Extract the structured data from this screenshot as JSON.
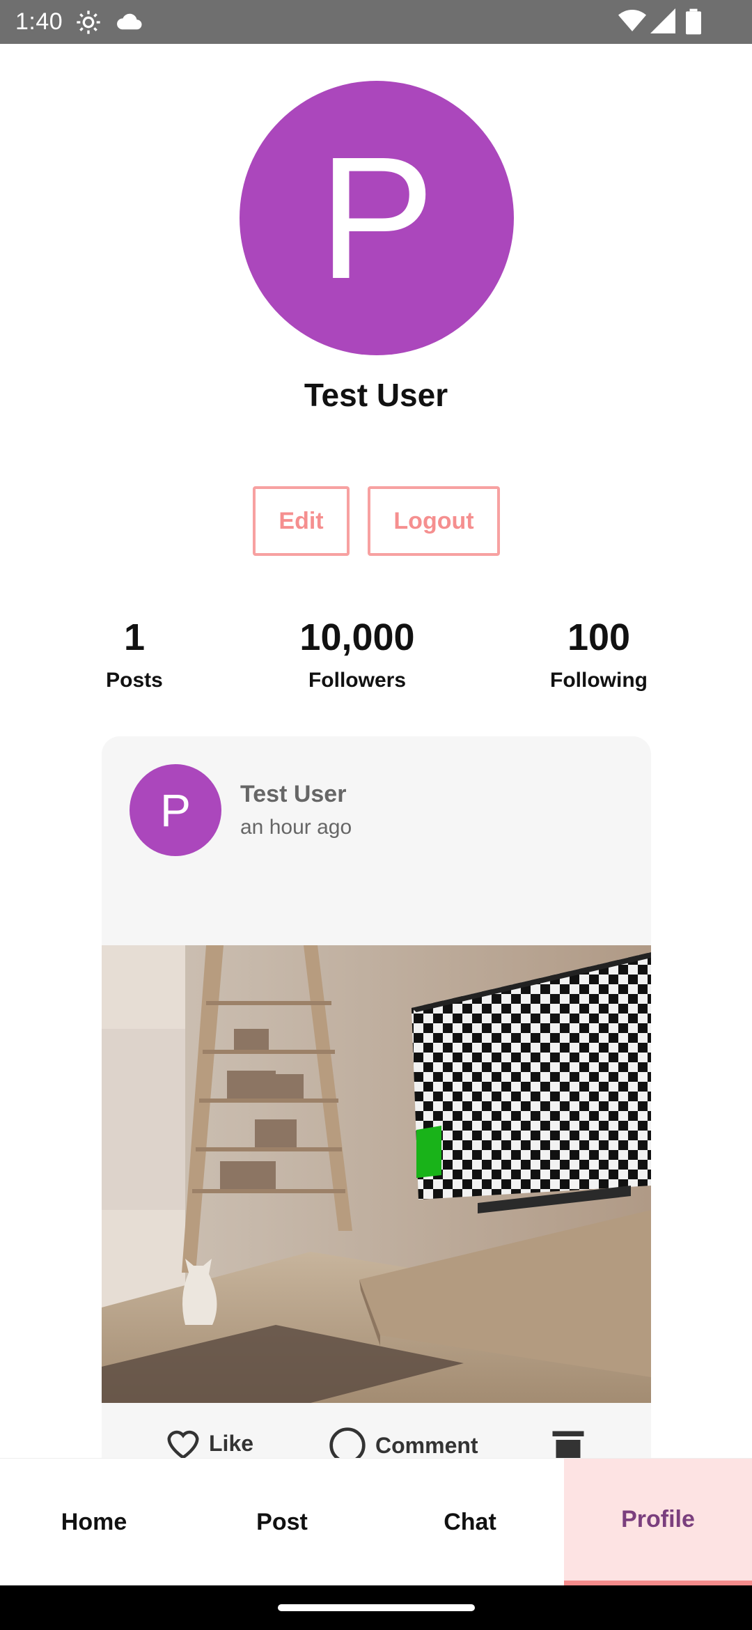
{
  "status_bar": {
    "time": "1:40",
    "icons": [
      "settings-icon",
      "cloud-icon",
      "wifi-icon",
      "signal-icon",
      "battery-icon"
    ]
  },
  "profile": {
    "avatar_letter": "P",
    "avatar_color": "#ab47bc",
    "name": "Test User",
    "edit_label": "Edit",
    "logout_label": "Logout",
    "stats": [
      {
        "value": "1",
        "label": "Posts"
      },
      {
        "value": "10,000",
        "label": "Followers"
      },
      {
        "value": "100",
        "label": "Following"
      }
    ]
  },
  "post": {
    "avatar_letter": "P",
    "author": "Test User",
    "time": "an hour ago",
    "actions": {
      "like": "Like",
      "comment": "Comment"
    }
  },
  "bottom_nav": {
    "items": [
      "Home",
      "Post",
      "Chat",
      "Profile"
    ],
    "active": "Profile",
    "accent": "#f48b8b"
  }
}
